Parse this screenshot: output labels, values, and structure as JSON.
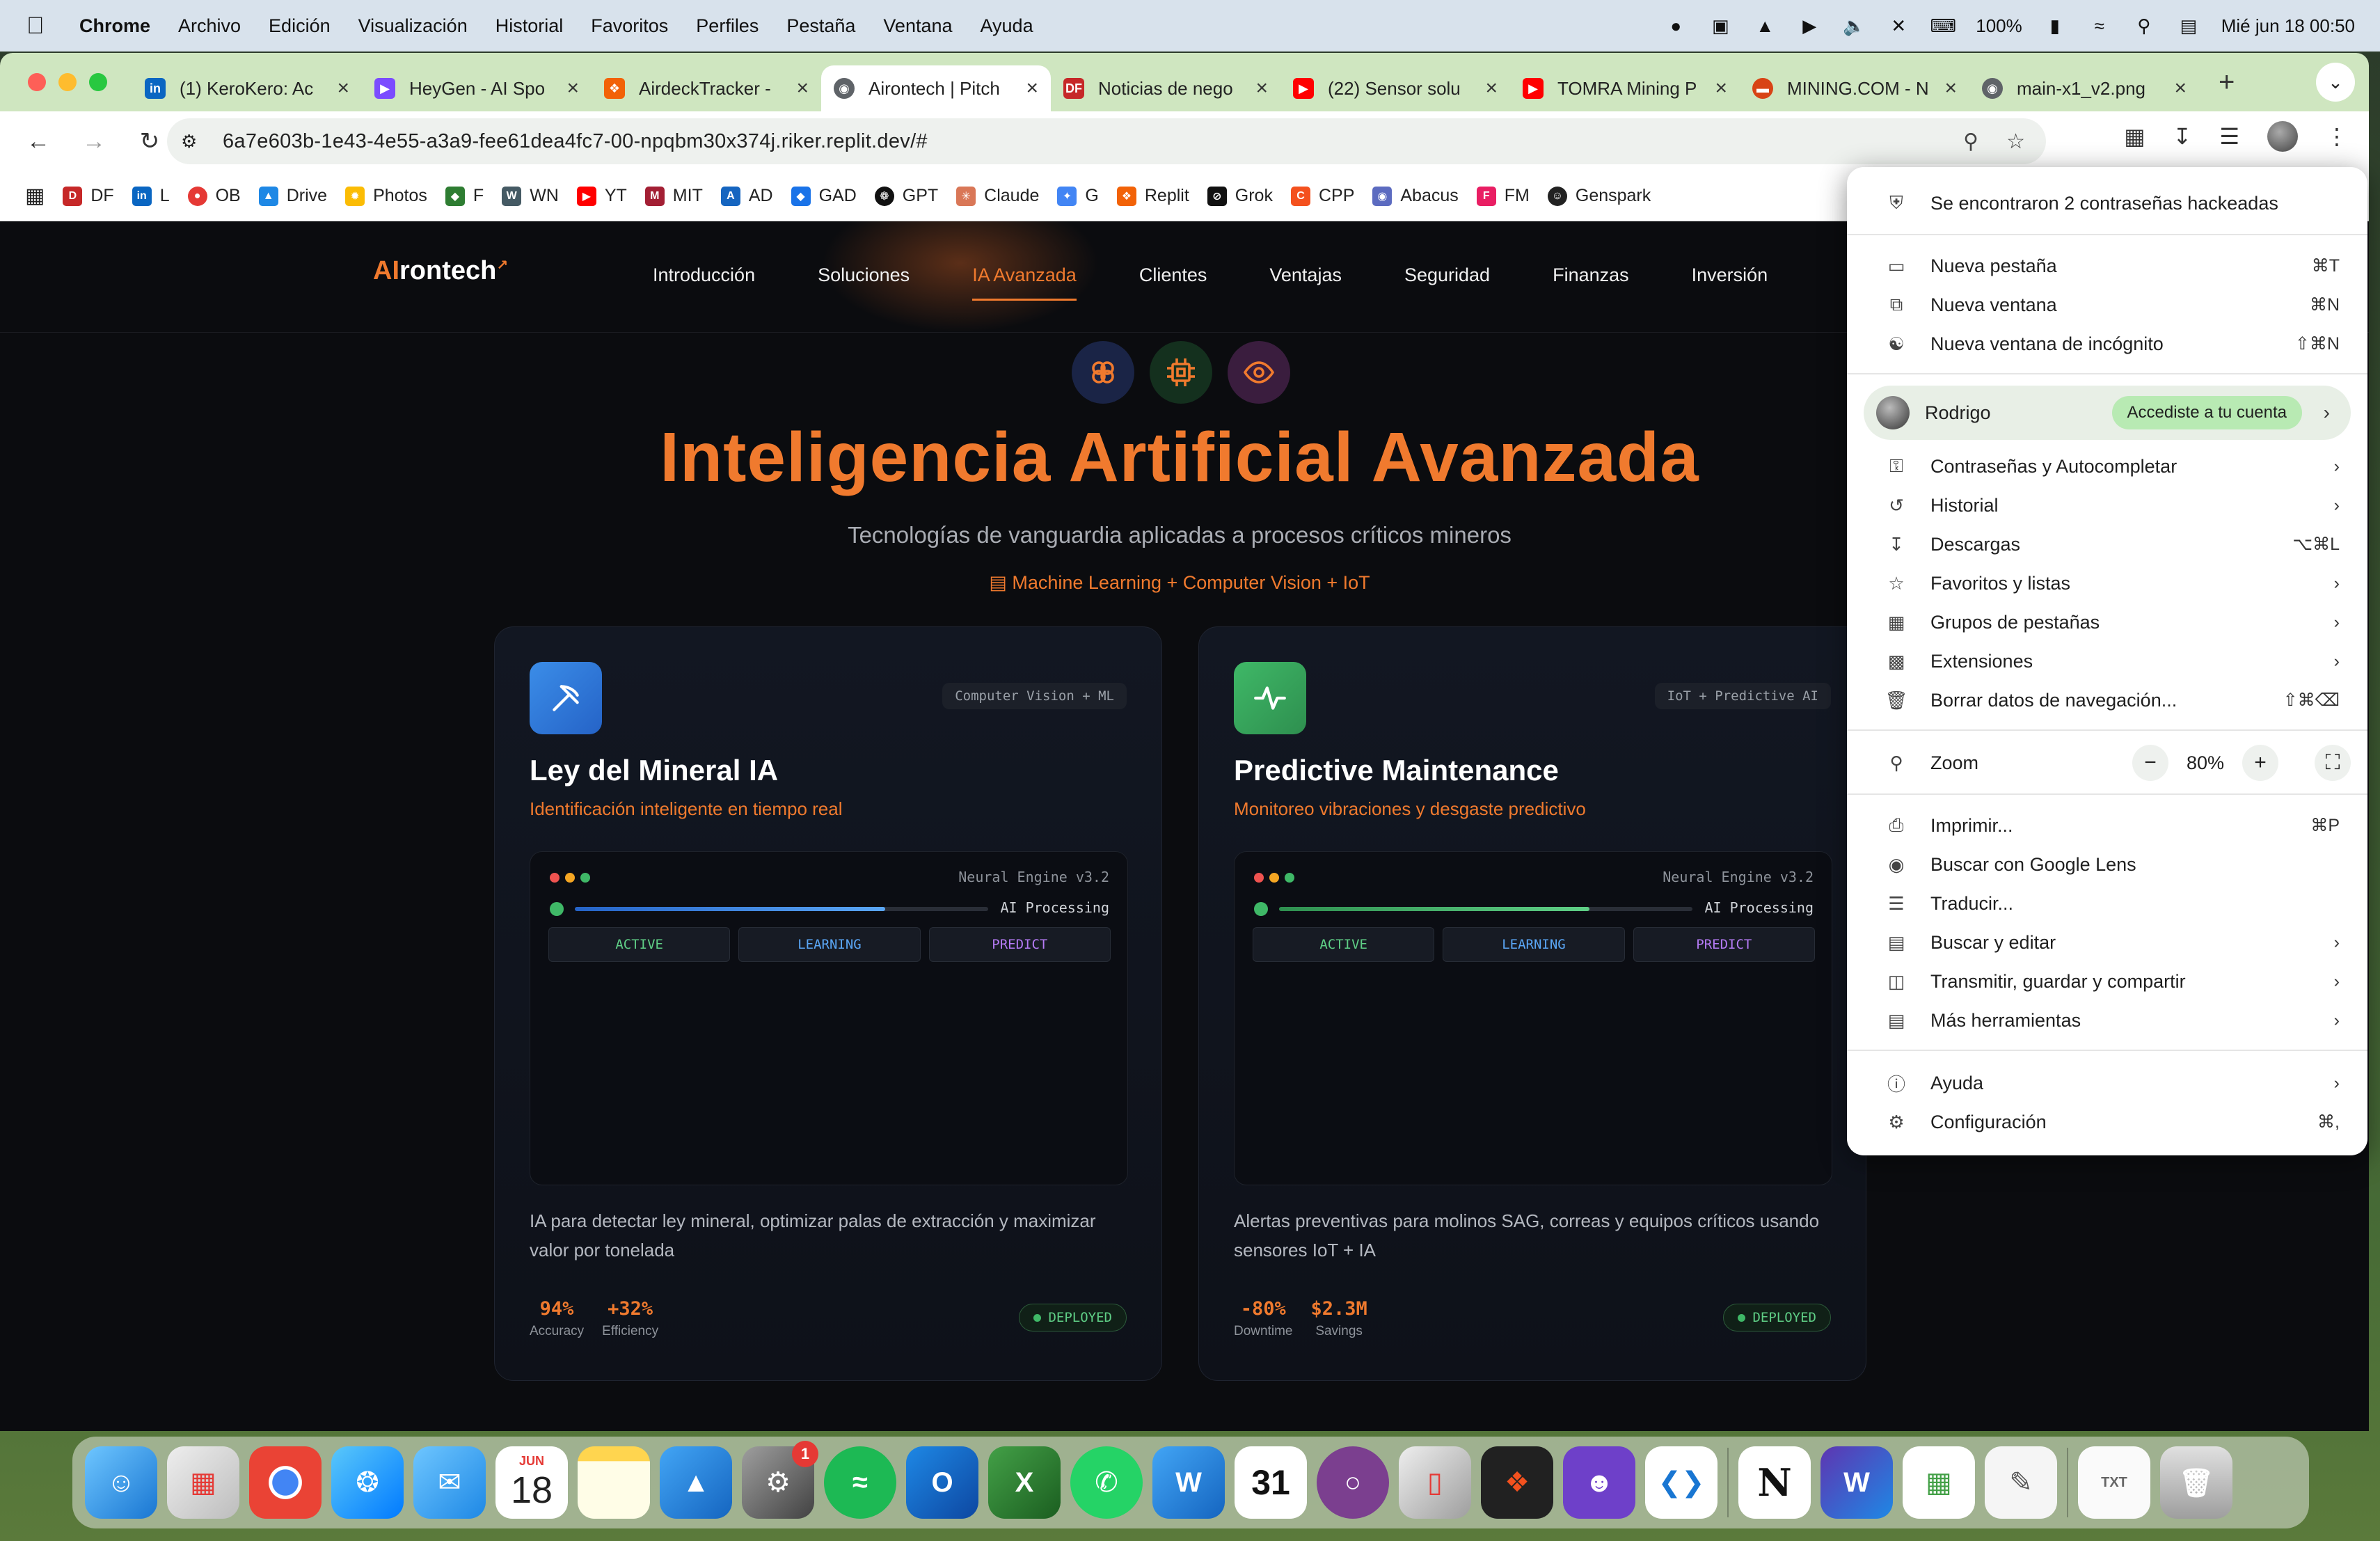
{
  "menubar": {
    "app_name": "Chrome",
    "menus": [
      "Archivo",
      "Edición",
      "Visualización",
      "Historial",
      "Favoritos",
      "Perfiles",
      "Pestaña",
      "Ventana",
      "Ayuda"
    ],
    "battery": "100%",
    "datetime": "Mié jun 18  00:50"
  },
  "tabs": [
    {
      "title": "(1) KeroKero: Ac",
      "icon": "linkedin-icon",
      "color": "#0a66c2"
    },
    {
      "title": "HeyGen - AI Spo",
      "icon": "heygen-icon",
      "color": "#7b4cff"
    },
    {
      "title": "AirdeckTracker -",
      "icon": "replit-icon",
      "color": "#f26207"
    },
    {
      "title": "Airontech | Pitch",
      "icon": "globe-icon",
      "color": "#5f6368",
      "active": true
    },
    {
      "title": "Noticias de nego",
      "icon": "df-icon",
      "color": "#c62828"
    },
    {
      "title": "(22) Sensor solu",
      "icon": "youtube-icon",
      "color": "#ff0000"
    },
    {
      "title": "TOMRA Mining P",
      "icon": "youtube-icon",
      "color": "#ff0000"
    },
    {
      "title": "MINING.COM - N",
      "icon": "mining-icon",
      "color": "#d84315"
    },
    {
      "title": "main-x1_v2.png",
      "icon": "globe-icon",
      "color": "#5f6368"
    }
  ],
  "address": {
    "url": "6a7e603b-1e43-4e55-a3a9-fee61dea4fc7-00-npqbm30x374j.riker.replit.dev/#"
  },
  "bookmarks": [
    {
      "label": "DF",
      "color": "#c62828"
    },
    {
      "label": "L",
      "color": "#0a66c2"
    },
    {
      "label": "OB",
      "color": "#e53935"
    },
    {
      "label": "Drive",
      "color": "#1e88e5"
    },
    {
      "label": "Photos",
      "color": "#fbbc04"
    },
    {
      "label": "F",
      "color": "#2e7d32"
    },
    {
      "label": "WN",
      "color": "#455a64"
    },
    {
      "label": "YT",
      "color": "#ff0000"
    },
    {
      "label": "MIT",
      "color": "#a31f34"
    },
    {
      "label": "AD",
      "color": "#1565c0"
    },
    {
      "label": "GAD",
      "color": "#1a73e8"
    },
    {
      "label": "GPT",
      "color": "#111111"
    },
    {
      "label": "Claude",
      "color": "#d97757"
    },
    {
      "label": "G",
      "color": "#4285f4"
    },
    {
      "label": "Replit",
      "color": "#f26207"
    },
    {
      "label": "Grok",
      "color": "#111111"
    },
    {
      "label": "CPP",
      "color": "#f4511e"
    },
    {
      "label": "Abacus",
      "color": "#5c6bc0"
    },
    {
      "label": "FM",
      "color": "#e91e63"
    },
    {
      "label": "Genspark",
      "color": "#222222"
    }
  ],
  "site": {
    "logo_ai": "AI",
    "logo_rest": "rontech",
    "nav": [
      "Introducción",
      "Soluciones",
      "IA Avanzada",
      "Clientes",
      "Ventajas",
      "Seguridad",
      "Finanzas",
      "Inversión"
    ],
    "active_nav": "IA Avanzada",
    "title": "Inteligencia Artificial Avanzada",
    "subtitle": "Tecnologías de vanguardia aplicadas a procesos críticos mineros",
    "tagline": "Machine Learning + Computer Vision + IoT",
    "cards": [
      {
        "title": "Ley del Mineral IA",
        "tag": "Computer Vision + ML",
        "subtitle": "Identificación inteligente en tiempo real",
        "engine": "Neural Engine v3.2",
        "processing": "AI Processing",
        "progress": 0.75,
        "chips": [
          "ACTIVE",
          "LEARNING",
          "PREDICT"
        ],
        "description": "IA para detectar ley mineral, optimizar palas de extracción y maximizar valor por tonelada",
        "stats": [
          {
            "value": "94%",
            "label": "Accuracy"
          },
          {
            "value": "+32%",
            "label": "Efficiency"
          }
        ],
        "status": "DEPLOYED"
      },
      {
        "title": "Predictive Maintenance",
        "tag": "IoT + Predictive AI",
        "subtitle": "Monitoreo vibraciones y desgaste predictivo",
        "engine": "Neural Engine v3.2",
        "processing": "AI Processing",
        "progress": 0.75,
        "chips": [
          "ACTIVE",
          "LEARNING",
          "PREDICT"
        ],
        "description": "Alertas preventivas para molinos SAG, correas y equipos críticos usando sensores IoT + IA",
        "stats": [
          {
            "value": "-80%",
            "label": "Downtime"
          },
          {
            "value": "$2.3M",
            "label": "Savings"
          }
        ],
        "status": "DEPLOYED"
      }
    ]
  },
  "chrome_menu": {
    "alert": "Se encontraron 2 contraseñas hackeadas",
    "group1": [
      {
        "label": "Nueva pestaña",
        "shortcut": "⌘T"
      },
      {
        "label": "Nueva ventana",
        "shortcut": "⌘N"
      },
      {
        "label": "Nueva ventana de incógnito",
        "shortcut": "⇧⌘N"
      }
    ],
    "profile_name": "Rodrigo",
    "profile_badge": "Accediste a tu cuenta",
    "group2": [
      {
        "label": "Contraseñas y Autocompletar",
        "shortcut": "›"
      },
      {
        "label": "Historial",
        "shortcut": "›"
      },
      {
        "label": "Descargas",
        "shortcut": "⌥⌘L"
      },
      {
        "label": "Favoritos y listas",
        "shortcut": "›"
      },
      {
        "label": "Grupos de pestañas",
        "shortcut": "›"
      },
      {
        "label": "Extensiones",
        "shortcut": "›"
      },
      {
        "label": "Borrar datos de navegación...",
        "shortcut": "⇧⌘⌫"
      }
    ],
    "zoom_label": "Zoom",
    "zoom_value": "80%",
    "group3": [
      {
        "label": "Imprimir...",
        "shortcut": "⌘P"
      },
      {
        "label": "Buscar con Google Lens",
        "shortcut": ""
      },
      {
        "label": "Traducir...",
        "shortcut": ""
      },
      {
        "label": "Buscar y editar",
        "shortcut": "›"
      },
      {
        "label": "Transmitir, guardar y compartir",
        "shortcut": "›"
      },
      {
        "label": "Más herramientas",
        "shortcut": "›"
      }
    ],
    "group4": [
      {
        "label": "Ayuda",
        "shortcut": "›"
      },
      {
        "label": "Configuración",
        "shortcut": "⌘,"
      }
    ]
  },
  "dock": {
    "calendar_month": "JUN",
    "calendar_day": "18",
    "settings_badge": "1",
    "calendar2_day": "31"
  }
}
